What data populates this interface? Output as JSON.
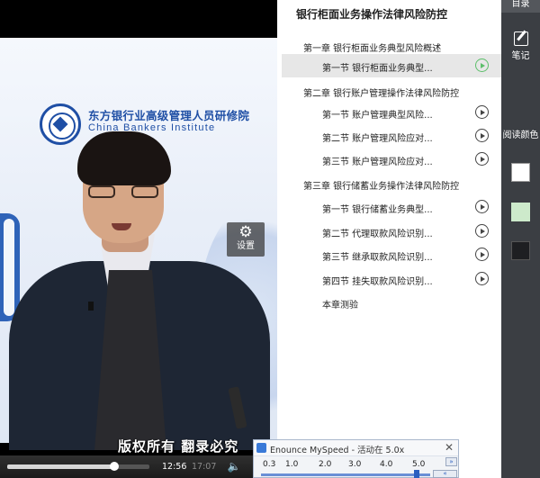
{
  "video": {
    "institute_cn": "东方银行业高级管理人员研修院",
    "institute_en": "China Bankers Institute",
    "settings_label": "设置",
    "watermark": "版权所有  翻录必究",
    "current_time": "12:56",
    "total_time": "17:07",
    "progress": 0.756
  },
  "toc": {
    "title": "银行柜面业务操作法律风险防控",
    "items": [
      {
        "type": "chapter",
        "label": "第一章  银行柜面业务典型风险概述",
        "play": false,
        "active": false
      },
      {
        "type": "section",
        "label": "第一节  银行柜面业务典型...",
        "play": true,
        "active": true
      },
      {
        "type": "chapter",
        "label": "第二章  银行账户管理操作法律风险防控",
        "play": false,
        "active": false
      },
      {
        "type": "section",
        "label": "第一节  账户管理典型风险...",
        "play": true,
        "active": false
      },
      {
        "type": "section",
        "label": "第二节  账户管理风险应对...",
        "play": true,
        "active": false
      },
      {
        "type": "section",
        "label": "第三节  账户管理风险应对...",
        "play": true,
        "active": false
      },
      {
        "type": "chapter",
        "label": "第三章  银行储蓄业务操作法律风险防控",
        "play": false,
        "active": false
      },
      {
        "type": "section",
        "label": "第一节  银行储蓄业务典型...",
        "play": true,
        "active": false
      },
      {
        "type": "section",
        "label": "第二节  代理取款风险识别...",
        "play": true,
        "active": false
      },
      {
        "type": "section",
        "label": "第三节  继承取款风险识别...",
        "play": true,
        "active": false
      },
      {
        "type": "section",
        "label": "第四节  挂失取款风险识别...",
        "play": true,
        "active": false
      },
      {
        "type": "section",
        "label": "本章测验",
        "play": false,
        "active": false
      }
    ]
  },
  "sidebar": {
    "toc_tab": "目录",
    "notes_label": "笔记",
    "read_color_label": "阅读颜色",
    "colors": [
      "#ffffff",
      "#cdeacb",
      "#1e1f22"
    ]
  },
  "speed_popup": {
    "title": "Enounce MySpeed - 活动在 5.0x",
    "ticks": [
      "0.3",
      "1.0",
      "2.0",
      "3.0",
      "4.0",
      "5.0"
    ],
    "value": 5.0
  }
}
